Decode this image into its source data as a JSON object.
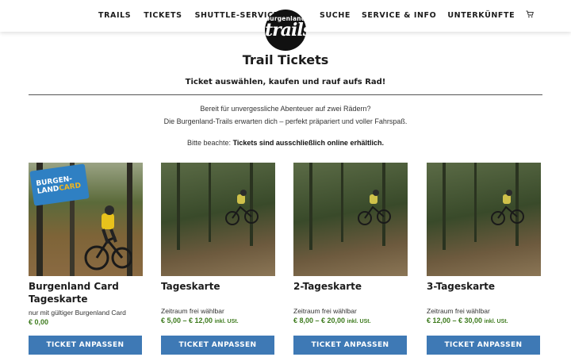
{
  "header": {
    "nav_left": [
      "TRAILS",
      "TICKETS",
      "SHUTTLE-SERVICE"
    ],
    "nav_right": [
      "SUCHE",
      "SERVICE & INFO",
      "UNTERKÜNFTE"
    ],
    "logo_small": "burgenland",
    "logo_big": "trails",
    "cart_icon": "cart-icon"
  },
  "page": {
    "title": "Trail Tickets",
    "subtitle": "Ticket auswählen, kaufen und rauf aufs Rad!",
    "intro_line1": "Bereit für unvergessliche Abenteuer auf zwei Rädern?",
    "intro_line2": "Die Burgenland-Trails erwarten dich – perfekt präpariert und voller Fahrspaß.",
    "note_prefix": "Bitte beachte: ",
    "note_bold": "Tickets sind ausschließlich online erhältlich."
  },
  "products": [
    {
      "name": "Burgenland Card Tageskarte",
      "desc": "nur mit gültiger Burgenland Card",
      "price": "€ 0,00",
      "tax": "",
      "badge_line1": "BURGEN-",
      "badge_line2a": "LAND",
      "badge_line2b": "CARD",
      "button": "TICKET ANPASSEN"
    },
    {
      "name": "Tageskarte",
      "desc": "Zeitraum frei wählbar",
      "price": "€ 5,00 – € 12,00",
      "tax": "inkl. USt.",
      "button": "TICKET ANPASSEN"
    },
    {
      "name": "2-Tageskarte",
      "desc": "Zeitraum frei wählbar",
      "price": "€ 8,00 – € 20,00",
      "tax": "inkl. USt.",
      "button": "TICKET ANPASSEN"
    },
    {
      "name": "3-Tageskarte",
      "desc": "Zeitraum frei wählbar",
      "price": "€ 12,00 – € 30,00",
      "tax": "inkl. USt.",
      "button": "TICKET ANPASSEN"
    }
  ],
  "colors": {
    "price_green": "#3e7b1e",
    "button_blue": "#3e79b5",
    "card_blue": "#2f80c3"
  }
}
